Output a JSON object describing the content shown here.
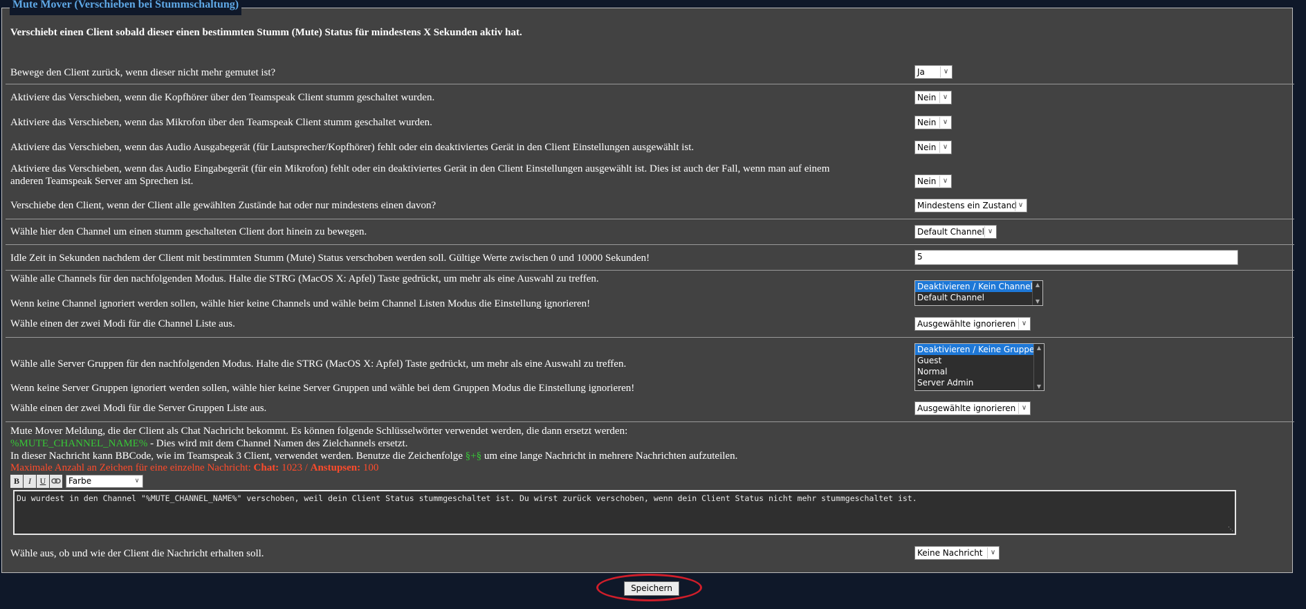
{
  "section": {
    "title": "Mute Mover (Verschieben bei Stummschaltung)",
    "description": "Verschiebt einen Client sobald dieser einen bestimmten Stumm (Mute) Status für mindestens X Sekunden aktiv hat."
  },
  "rows": {
    "move_back": {
      "label": "Bewege den Client zurück, wenn dieser nicht mehr gemutet ist?",
      "value": "Ja"
    },
    "headphones": {
      "label": "Aktiviere das Verschieben, wenn die Kopfhörer über den Teamspeak Client stumm geschaltet wurden.",
      "value": "Nein"
    },
    "microphone": {
      "label": "Aktiviere das Verschieben, wenn das Mikrofon über den Teamspeak Client stumm geschaltet wurden.",
      "value": "Nein"
    },
    "output_device": {
      "label": "Aktiviere das Verschieben, wenn das Audio Ausgabegerät (für Lautsprecher/Kopfhörer) fehlt oder ein deaktiviertes Gerät in den Client Einstellungen ausgewählt ist.",
      "value": "Nein"
    },
    "input_device": {
      "label_line1": "Aktiviere das Verschieben, wenn das Audio Eingabegerät (für ein Mikrofon) fehlt oder ein deaktiviertes Gerät in den Client Einstellungen ausgewählt ist. Dies ist auch der Fall, wenn man auf einem",
      "label_line2": "anderen Teamspeak Server am Sprechen ist.",
      "value": "Nein"
    },
    "states_mode": {
      "label": "Verschiebe den Client, wenn der Client alle gewählten Zustände hat oder nur mindestens einen davon?",
      "value": "Mindestens ein Zustand"
    },
    "target_channel": {
      "label": "Wähle hier den Channel um einen stumm geschalteten Client dort hinein zu bewegen.",
      "value": "Default Channel"
    },
    "idle_time": {
      "label": "Idle Zeit in Sekunden nachdem der Client mit bestimmten Stumm (Mute) Status verschoben werden soll. Gültige Werte zwischen 0 und 10000 Sekunden!",
      "value": "5"
    },
    "channels": {
      "label": "Wähle alle Channels für den nachfolgenden Modus. Halte die STRG (MacOS X: Apfel) Taste gedrückt, um mehr als eine Auswahl zu treffen.",
      "hint": "Wenn keine Channel ignoriert werden sollen, wähle hier keine Channels und wähle beim Channel Listen Modus die Einstellung ignorieren!",
      "options": [
        "Deaktivieren / Kein Channel",
        "Default Channel"
      ],
      "selected": "Deaktivieren / Kein Channel"
    },
    "channel_mode": {
      "label": "Wähle einen der zwei Modi für die Channel Liste aus.",
      "value": "Ausgewählte ignorieren"
    },
    "groups": {
      "label": "Wähle alle Server Gruppen für den nachfolgenden Modus. Halte die STRG (MacOS X: Apfel) Taste gedrückt, um mehr als eine Auswahl zu treffen.",
      "hint": "Wenn keine Server Gruppen ignoriert werden sollen, wähle hier keine Server Gruppen und wähle bei dem Gruppen Modus die Einstellung ignorieren!",
      "options": [
        "Deaktivieren / Keine Gruppe",
        "Guest",
        "Normal",
        "Server Admin"
      ],
      "selected": "Deaktivieren / Keine Gruppe"
    },
    "group_mode": {
      "label": "Wähle einen der zwei Modi für die Server Gruppen Liste aus.",
      "value": "Ausgewählte ignorieren"
    }
  },
  "message": {
    "intro": "Mute Mover Meldung, die der Client als Chat Nachricht bekommt. Es können folgende Schlüsselwörter verwendet werden, die dann ersetzt werden:",
    "keyword": "%MUTE_CHANNEL_NAME%",
    "keyword_desc": " - Dies wird mit dem Channel Namen des Zielchannels ersetzt.",
    "bbcode_pre": "In dieser Nachricht kann BBCode, wie im Teamspeak 3 Client, verwendet werden. Benutze die Zeichenfolge ",
    "split_token": "§+§",
    "bbcode_post": " um eine lange Nachricht in mehrere Nachrichten aufzuteilen.",
    "max_chars_prefix": "Maximale Anzahl an Zeichen für eine einzelne Nachricht: ",
    "chat_label": "Chat:",
    "chat_value": " 1023",
    "separator": " / ",
    "poke_label": "Anstupsen:",
    "poke_value": " 100",
    "toolbar": {
      "bold": "B",
      "italic": "I",
      "underline": "U",
      "link_icon": "link-icon",
      "color_select": "Farbe"
    },
    "text": "Du wurdest in den Channel \"%MUTE_CHANNEL_NAME%\" verschoben, weil dein Client Status stummgeschaltet ist. Du wirst zurück verschoben, wenn dein Client Status nicht mehr stummgeschaltet ist.",
    "delivery_label": "Wähle aus, ob und wie der Client die Nachricht erhalten soll.",
    "delivery_value": "Keine Nachricht"
  },
  "save_button": "Speichern",
  "colors": {
    "page_bg": "#0f1829",
    "panel_bg": "#424242",
    "title": "#5fa8e6",
    "keyword": "#37c837",
    "warning": "#ff4b2b",
    "highlight": "#d01e2a"
  }
}
